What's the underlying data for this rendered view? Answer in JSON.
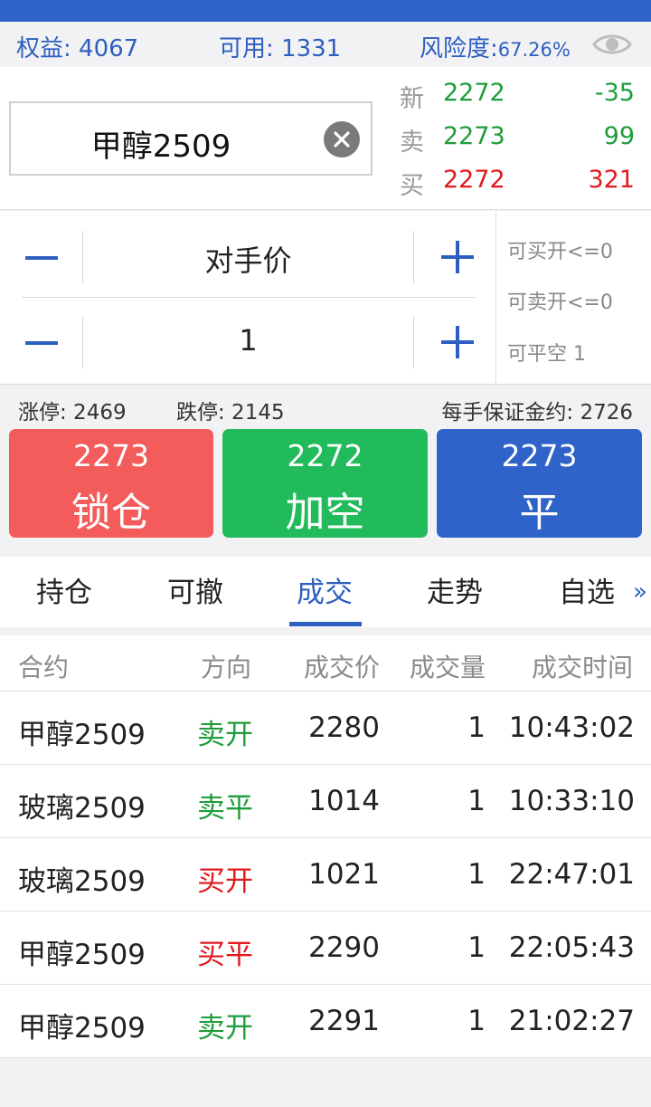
{
  "account": {
    "equity_label": "权益:",
    "equity_value": "4067",
    "available_label": "可用:",
    "available_value": "1331",
    "risk_label": "风险度:",
    "risk_value": "67.26%"
  },
  "contract": {
    "name": "甲醇2509"
  },
  "quote": {
    "new": {
      "label": "新",
      "price": "2272",
      "change": "-35"
    },
    "sell": {
      "label": "卖",
      "price": "2273",
      "volume": "99"
    },
    "buy": {
      "label": "买",
      "price": "2272",
      "volume": "321"
    }
  },
  "order": {
    "price_type": "对手价",
    "quantity": "1",
    "can_buy_open": "可买开<=0",
    "can_sell_open": "可卖开<=0",
    "can_close_short": "可平空 1"
  },
  "limits": {
    "limit_up": "涨停: 2469",
    "limit_down": "跌停: 2145",
    "margin": "每手保证金约: 2726"
  },
  "actions": {
    "lock": {
      "price": "2273",
      "label": "锁仓"
    },
    "short": {
      "price": "2272",
      "label": "加空"
    },
    "close": {
      "price": "2273",
      "label": "平"
    }
  },
  "tabs": [
    "持仓",
    "可撤",
    "成交",
    "走势",
    "自选"
  ],
  "active_tab": "成交",
  "trades": {
    "headers": [
      "合约",
      "方向",
      "成交价",
      "成交量",
      "成交时间"
    ],
    "rows": [
      {
        "contract": "甲醇2509",
        "direction": "卖开",
        "price": "2280",
        "qty": "1",
        "time": "10:43:02",
        "dir_color": "green"
      },
      {
        "contract": "玻璃2509",
        "direction": "卖平",
        "price": "1014",
        "qty": "1",
        "time": "10:33:10",
        "dir_color": "green"
      },
      {
        "contract": "玻璃2509",
        "direction": "买开",
        "price": "1021",
        "qty": "1",
        "time": "22:47:01",
        "dir_color": "red"
      },
      {
        "contract": "甲醇2509",
        "direction": "买平",
        "price": "2290",
        "qty": "1",
        "time": "22:05:43",
        "dir_color": "red"
      },
      {
        "contract": "甲醇2509",
        "direction": "卖开",
        "price": "2291",
        "qty": "1",
        "time": "21:02:27",
        "dir_color": "green"
      }
    ]
  },
  "colors": {
    "accent": "#2d5fc0",
    "up": "#e0191e",
    "down": "#1f9d3a",
    "lock_button": "#f45b5b",
    "short_button": "#22bb5c",
    "close_button": "#2f63c9"
  }
}
